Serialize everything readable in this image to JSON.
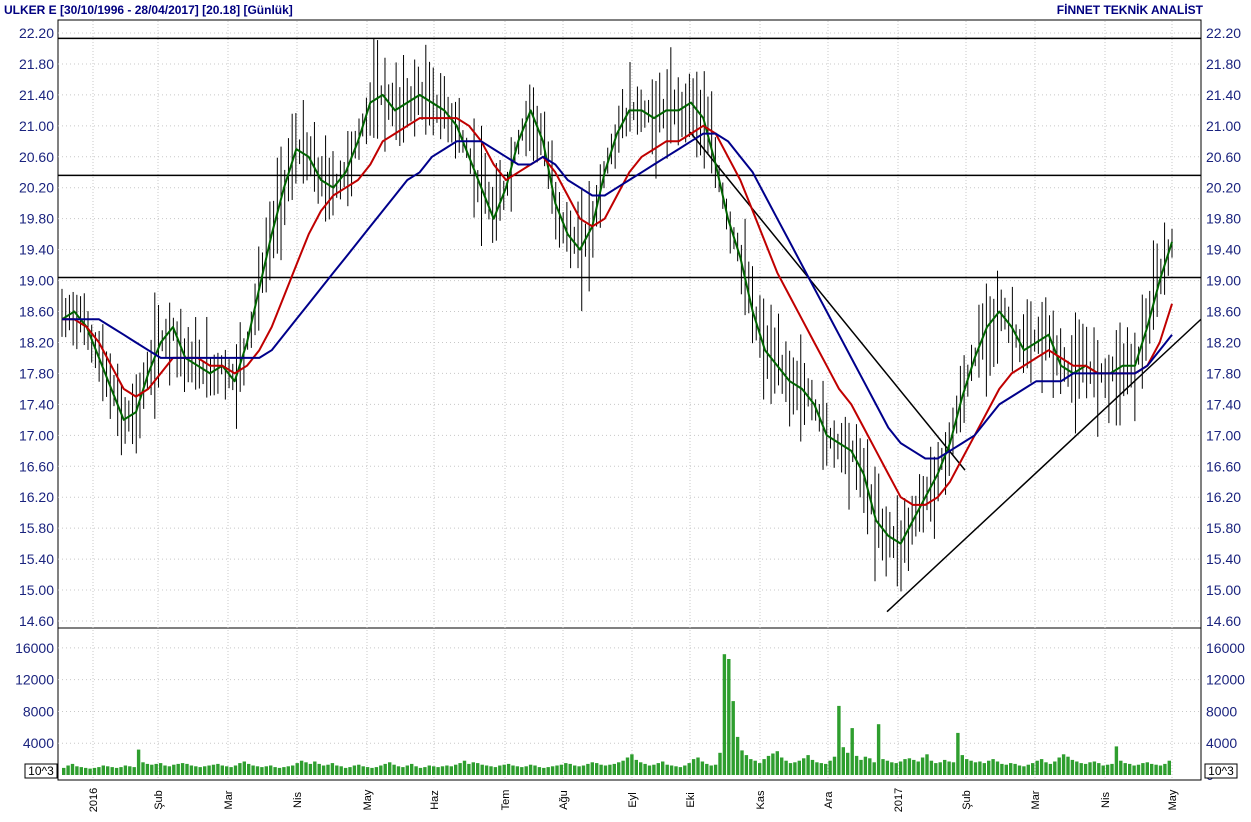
{
  "header": {
    "left": "ULKER E  [30/10/1996 - 28/04/2017]  [20.18]  [Günlük]",
    "right": "FİNNET TEKNİK ANALİST"
  },
  "colors": {
    "price_bars": "#000000",
    "ma_short": "#006400",
    "ma_mid": "#c00000",
    "ma_long": "#00008b",
    "volume": "#2e9e2e",
    "grid": "#c8c8c8",
    "tick_text": "#1a237e"
  },
  "chart_data": [
    {
      "type": "line",
      "title": "",
      "ylim": [
        14.6,
        22.2
      ],
      "yticks": [
        "22.20",
        "21.80",
        "21.40",
        "21.00",
        "20.60",
        "20.20",
        "19.80",
        "19.40",
        "19.00",
        "18.60",
        "18.20",
        "17.80",
        "17.40",
        "17.00",
        "16.60",
        "16.20",
        "15.80",
        "15.40",
        "15.00",
        "14.60"
      ],
      "x_labels": [
        "2016",
        "Şub",
        "Mar",
        "Nis",
        "May",
        "Haz",
        "Tem",
        "Ağu",
        "Eyl",
        "Eki",
        "Kas",
        "Ara",
        "2017",
        "Şub",
        "Mar",
        "Nis",
        "May"
      ],
      "last_price": 20.18,
      "horizontal_lines": [
        22.13,
        20.36,
        19.04
      ],
      "trendlines": [
        {
          "from": [
            "Eki",
            20.92
          ],
          "to": [
            "2017-Ocak",
            16.55
          ]
        },
        {
          "from": [
            "2017-Ocak",
            14.72
          ],
          "to": [
            "May",
            18.5
          ]
        }
      ],
      "series": [
        {
          "values": [
            18.5,
            18.6,
            18.4,
            18.0,
            17.6,
            17.2,
            17.3,
            17.8,
            18.2,
            18.4,
            18.0,
            17.9,
            17.8,
            17.9,
            17.7,
            18.2,
            18.9,
            19.6,
            20.2,
            20.7,
            20.6,
            20.3,
            20.2,
            20.4,
            20.8,
            21.3,
            21.4,
            21.2,
            21.3,
            21.4,
            21.3,
            21.2,
            21.0,
            20.6,
            20.2,
            19.8,
            20.2,
            20.8,
            21.2,
            20.8,
            20.0,
            19.6,
            19.4,
            19.7,
            20.4,
            20.9,
            21.2,
            21.2,
            21.1,
            21.2,
            21.2,
            21.3,
            21.1,
            20.5,
            19.8,
            19.3,
            18.6,
            18.1,
            17.9,
            17.7,
            17.6,
            17.4,
            17.0,
            16.9,
            16.8,
            16.5,
            15.9,
            15.7,
            15.6,
            15.9,
            16.2,
            16.5,
            16.9,
            17.5,
            18.0,
            18.4,
            18.6,
            18.4,
            18.1,
            18.2,
            18.3,
            17.9,
            17.8,
            17.9,
            17.8,
            17.8,
            17.9,
            17.9,
            18.4,
            19.0,
            19.5
          ]
        },
        {
          "values": [
            18.5,
            18.5,
            18.4,
            18.2,
            17.9,
            17.6,
            17.5,
            17.6,
            17.8,
            18.0,
            18.0,
            18.0,
            17.9,
            17.9,
            17.8,
            17.9,
            18.1,
            18.4,
            18.8,
            19.2,
            19.6,
            19.9,
            20.1,
            20.2,
            20.3,
            20.5,
            20.8,
            20.9,
            21.0,
            21.1,
            21.1,
            21.1,
            21.1,
            21.0,
            20.8,
            20.5,
            20.3,
            20.4,
            20.5,
            20.6,
            20.4,
            20.1,
            19.8,
            19.7,
            19.8,
            20.1,
            20.4,
            20.6,
            20.7,
            20.8,
            20.8,
            20.9,
            21.0,
            20.9,
            20.6,
            20.3,
            19.9,
            19.5,
            19.1,
            18.8,
            18.5,
            18.2,
            17.9,
            17.6,
            17.4,
            17.1,
            16.8,
            16.5,
            16.2,
            16.1,
            16.1,
            16.2,
            16.4,
            16.7,
            17.0,
            17.3,
            17.6,
            17.8,
            17.9,
            18.0,
            18.1,
            18.0,
            17.9,
            17.9,
            17.8,
            17.8,
            17.8,
            17.8,
            17.9,
            18.2,
            18.7
          ]
        },
        {
          "values": [
            18.5,
            18.5,
            18.5,
            18.5,
            18.4,
            18.3,
            18.2,
            18.1,
            18.0,
            18.0,
            18.0,
            18.0,
            18.0,
            18.0,
            18.0,
            18.0,
            18.0,
            18.1,
            18.3,
            18.5,
            18.7,
            18.9,
            19.1,
            19.3,
            19.5,
            19.7,
            19.9,
            20.1,
            20.3,
            20.4,
            20.6,
            20.7,
            20.8,
            20.8,
            20.8,
            20.7,
            20.6,
            20.5,
            20.5,
            20.6,
            20.5,
            20.3,
            20.2,
            20.1,
            20.1,
            20.2,
            20.3,
            20.4,
            20.5,
            20.6,
            20.7,
            20.8,
            20.9,
            20.9,
            20.8,
            20.6,
            20.4,
            20.1,
            19.8,
            19.5,
            19.2,
            18.9,
            18.6,
            18.3,
            18.0,
            17.7,
            17.4,
            17.1,
            16.9,
            16.8,
            16.7,
            16.7,
            16.8,
            16.9,
            17.0,
            17.2,
            17.4,
            17.5,
            17.6,
            17.7,
            17.7,
            17.7,
            17.8,
            17.8,
            17.8,
            17.8,
            17.8,
            17.8,
            17.9,
            18.1,
            18.3
          ]
        }
      ]
    },
    {
      "type": "bar",
      "title": "",
      "unit_label": "10^3",
      "ylim": [
        0,
        18000
      ],
      "yticks": [
        "16000",
        "12000",
        "8000",
        "4000",
        "0"
      ],
      "values": [
        900,
        1200,
        1400,
        1100,
        1000,
        900,
        800,
        900,
        1000,
        1200,
        1100,
        1000,
        900,
        1000,
        1200,
        1100,
        1000,
        3200,
        1600,
        1400,
        1300,
        1400,
        1500,
        1200,
        1100,
        1300,
        1400,
        1500,
        1400,
        1200,
        1100,
        1000,
        1100,
        1200,
        1300,
        1400,
        1200,
        1100,
        1000,
        1200,
        1500,
        1700,
        1400,
        1200,
        1100,
        1000,
        1100,
        1200,
        1000,
        900,
        1000,
        1100,
        1200,
        1500,
        1800,
        1600,
        1400,
        1700,
        1400,
        1200,
        1300,
        1500,
        1200,
        1100,
        900,
        1000,
        1200,
        1300,
        1100,
        1000,
        900,
        1000,
        1200,
        1400,
        1600,
        1300,
        1100,
        1000,
        1200,
        1400,
        1100,
        900,
        1000,
        1200,
        1100,
        1000,
        1100,
        1200,
        1100,
        1300,
        1500,
        1800,
        1400,
        1600,
        1500,
        1300,
        1200,
        1100,
        1000,
        1200,
        1300,
        1400,
        1200,
        1100,
        1000,
        1100,
        1300,
        1200,
        1000,
        900,
        1000,
        1100,
        1200,
        1300,
        1500,
        1400,
        1200,
        1100,
        1200,
        1400,
        1600,
        1500,
        1300,
        1200,
        1300,
        1400,
        1600,
        1800,
        2200,
        2600,
        1900,
        1600,
        1400,
        1200,
        1300,
        1500,
        1700,
        1300,
        1200,
        1100,
        1000,
        1200,
        1500,
        2000,
        2200,
        1700,
        1400,
        1200,
        1300,
        2800,
        15200,
        14600,
        9300,
        4800,
        3100,
        2500,
        2000,
        1800,
        1500,
        2000,
        2400,
        2700,
        3000,
        2200,
        1800,
        1500,
        1600,
        1800,
        2100,
        2500,
        1900,
        1600,
        1500,
        1400,
        1800,
        2300,
        8700,
        3500,
        2800,
        5900,
        2400,
        1900,
        2300,
        2100,
        1600,
        6400,
        2000,
        1800,
        1600,
        1500,
        1700,
        2000,
        2100,
        1900,
        1700,
        2200,
        2600,
        1800,
        1500,
        1600,
        1900,
        1700,
        1600,
        5300,
        2500,
        2000,
        1800,
        1600,
        1700,
        1500,
        1800,
        2000,
        1700,
        1400,
        1300,
        1500,
        1400,
        1200,
        1100,
        1300,
        1500,
        1800,
        2000,
        1600,
        1400,
        1700,
        2200,
        2600,
        2300,
        1900,
        1700,
        1500,
        1400,
        1600,
        1700,
        1500,
        1200,
        1300,
        1400,
        3600,
        1800,
        1500,
        1400,
        1200,
        1300,
        1500,
        1600,
        1400,
        1300,
        1200,
        1400,
        1800
      ]
    }
  ]
}
